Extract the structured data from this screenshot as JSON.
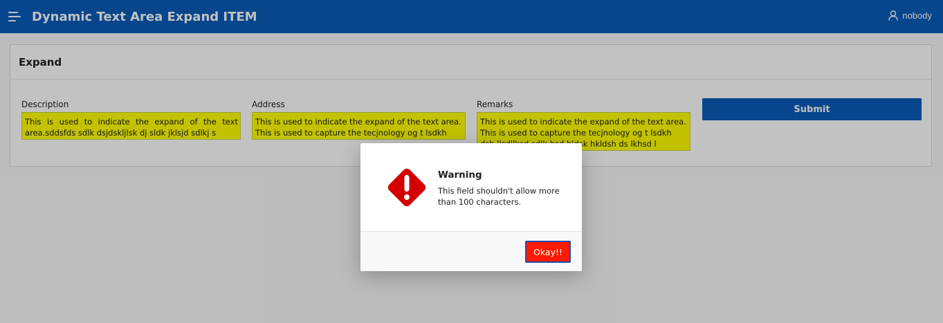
{
  "header": {
    "app_title": "Dynamic Text Area Expand ITEM",
    "user_name": "nobody"
  },
  "region": {
    "title": "Expand"
  },
  "fields": [
    {
      "label": "Description",
      "value": "This is used to indicate the expand of the text area.sddsfds sdlk dsjdskljlsk dj sldk jklsjd sdlkj s"
    },
    {
      "label": "Address",
      "value": "This is used to indicate the expand of the text area. This is used to capture the tecjnology og t lsdkh dsh ll"
    },
    {
      "label": "Remarks",
      "value": "This is used to indicate the expand of the text area. This is used to capture the tecjnology og t lsdkh dsh llsdllksd sdlk hsd hldsk hkldsh ds lkhsd l"
    }
  ],
  "submit_label": "Submit",
  "dialog": {
    "title": "Warning",
    "message": "This field shouldn't allow more than 100 characters.",
    "ok_label": "Okay!!",
    "icon": "warning-diamond-icon"
  },
  "colors": {
    "header_bg": "#0a5cb8",
    "textarea_bg": "#ffff00",
    "warning_red": "#d40000",
    "ok_button": "#ff1a00"
  }
}
